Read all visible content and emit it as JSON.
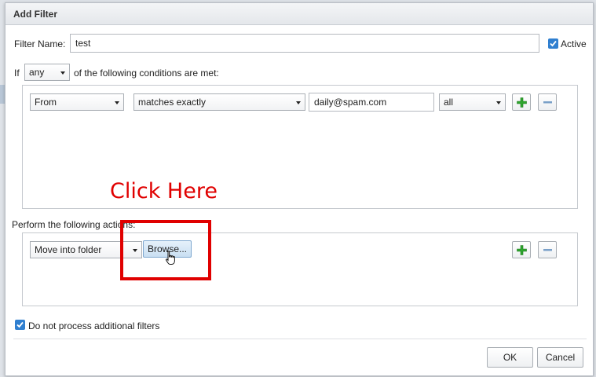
{
  "dialog": {
    "title": "Add Filter"
  },
  "filter_name": {
    "label": "Filter Name:",
    "value": "test"
  },
  "active": {
    "label": "Active",
    "checked": true
  },
  "conditions_line": {
    "prefix": "If",
    "match_select": "any",
    "suffix": "of the following conditions are met:"
  },
  "condition_row": {
    "field": "From",
    "operator": "matches exactly",
    "value": "daily@spam.com",
    "scope": "all"
  },
  "actions": {
    "label": "Perform the following actions:",
    "action_select": "Move into folder",
    "browse_label": "Browse..."
  },
  "annotation": {
    "text": "Click Here",
    "color": "#e00000"
  },
  "no_more_filters": {
    "label": "Do not process additional filters",
    "checked": true
  },
  "footer": {
    "ok_label": "OK",
    "cancel_label": "Cancel"
  },
  "icons": {
    "add": "plus-icon",
    "remove": "minus-icon",
    "check": "checkmark-icon",
    "cursor": "hand-pointer-icon"
  },
  "colors": {
    "accent": "#2f7fd0",
    "add_icon": "#2ea52e",
    "remove_icon": "#7aa0c8"
  }
}
